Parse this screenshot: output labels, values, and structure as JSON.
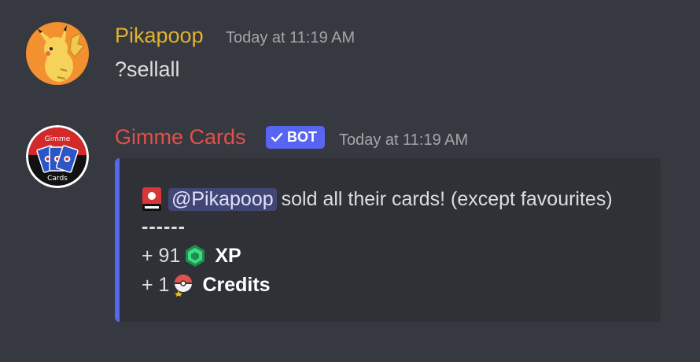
{
  "messages": [
    {
      "username": "Pikapoop",
      "username_color": "#e3b12d",
      "timestamp": "Today at 11:19 AM",
      "avatar_icon": "pikachu-avatar",
      "content": "?sellall"
    },
    {
      "username": "Gimme Cards",
      "username_color": "#e2504b",
      "badge": "BOT",
      "timestamp": "Today at 11:19 AM",
      "avatar_icon": "gimme-cards-logo",
      "avatar_text_top": "Gimme",
      "avatar_text_bottom": "Cards",
      "embed": {
        "accent_color": "#5865f2",
        "mention": "@Pikapoop",
        "line1_text": "sold all their cards! (except favourites)",
        "divider": "------",
        "xp_prefix": "+ 91",
        "xp_label": "XP",
        "credits_prefix": "+ 1",
        "credits_label": "Credits"
      }
    }
  ]
}
